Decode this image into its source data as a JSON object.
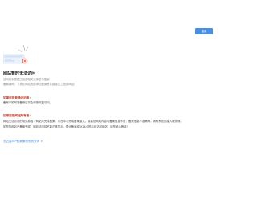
{
  "header": {
    "button_label": "备案"
  },
  "notice": {
    "title": "网站暂时无法访问",
    "subtitle_lines": [
      "该网站未根据工信部相关法律进行备案",
      "备案编码：（请在网站底部添加备案号并链接至工信部网站）"
    ]
  },
  "sections": [
    {
      "heading": "如果您是普通访问者：",
      "lines": [
        "备案中的网站备案后将会尽快恢复访问。"
      ]
    },
    {
      "heading": "如果您是网站所有者：",
      "lines": [
        "网站无法访问的常见原因：网站未完成备案，未在中心完成备案接入，或者您网站内容与备案信息不符，备案信息不准确等，请联系您的接入服务商。",
        "如您的网站已备案完成，网站访问将不能正常显示，预计备案成功24小时后可访问网站，请您耐心等待！"
      ]
    }
  ],
  "footer": {
    "link_label": "去云盾ICP备案管理系统查询 >"
  },
  "colors": {
    "accent": "#4a90e2",
    "heading": "#c0392b",
    "alert_icon": "#e74c3c"
  },
  "icons": {
    "illustration": "browser-error-illustration"
  }
}
